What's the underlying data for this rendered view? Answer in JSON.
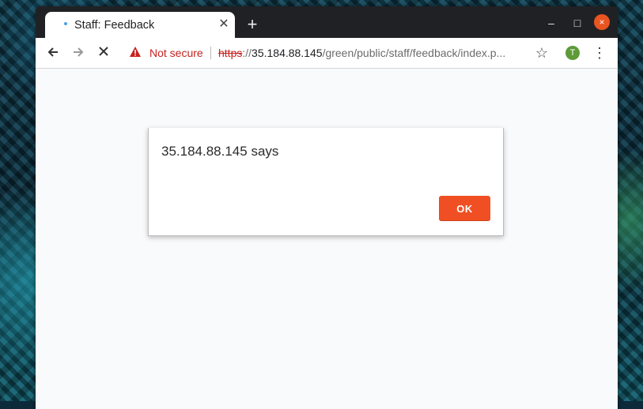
{
  "tab": {
    "title": "Staff: Feedback",
    "close_icon": "close-icon",
    "favicon": "loading-dot-icon"
  },
  "new_tab_icon": "plus-icon",
  "window_controls": {
    "minimize": "–",
    "maximize": "□",
    "close": "×"
  },
  "toolbar": {
    "back_icon": "arrow-left-icon",
    "forward_icon": "arrow-right-icon",
    "stop_icon": "close-icon",
    "security_label": "Not secure",
    "url_scheme": "https",
    "url_scheme_suffix": "://",
    "url_host": "35.184.88.145",
    "url_path": "/green/public/staff/feedback/index.p...",
    "bookmark_icon": "star-icon",
    "profile_initial": "T",
    "menu_icon": "three-dots-vertical-icon"
  },
  "dialog": {
    "title": "35.184.88.145 says",
    "ok_label": "OK"
  },
  "colors": {
    "ok_button": "#f04f23",
    "not_secure": "#c5221f",
    "window_close": "#e95420",
    "avatar": "#5e9a38"
  }
}
